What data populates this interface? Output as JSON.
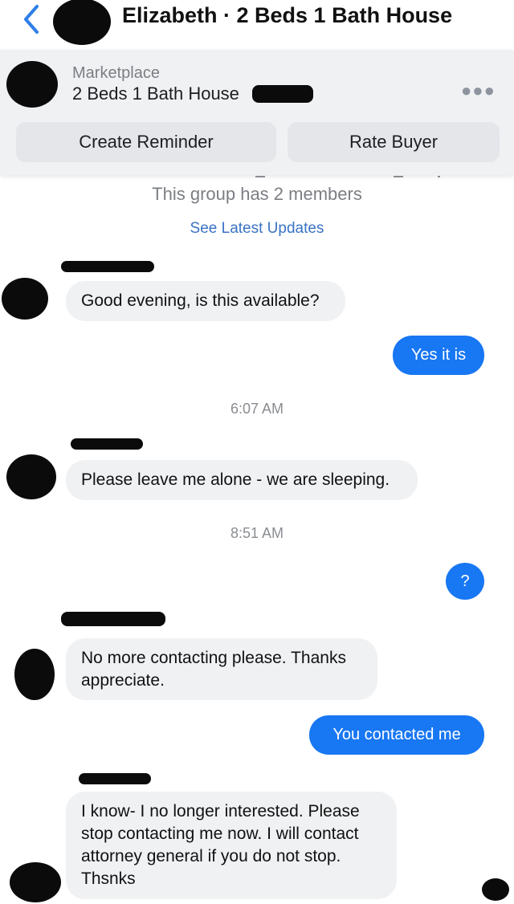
{
  "header": {
    "title": "Elizabeth · 2 Beds 1 Bath House"
  },
  "marketplace": {
    "label": "Marketplace",
    "listing_title": "2 Beds 1 Bath House",
    "create_reminder": "Create Reminder",
    "rate_buyer": "Rate Buyer"
  },
  "group": {
    "members_text": "This group has 2 members",
    "see_updates": "See Latest Updates"
  },
  "messages": [
    {
      "from": "them",
      "text": "Good evening, is this available?"
    },
    {
      "from": "me",
      "text": "Yes it is"
    },
    {
      "type": "time",
      "text": "6:07 AM"
    },
    {
      "from": "them",
      "text": "Please leave me alone - we are sleeping."
    },
    {
      "type": "time",
      "text": "8:51 AM"
    },
    {
      "from": "me",
      "text": "?"
    },
    {
      "from": "them",
      "text": "No more contacting please. Thanks appreciate."
    },
    {
      "from": "me",
      "text": "You contacted me"
    },
    {
      "from": "them",
      "text": "I know- I  no longer interested. Please stop contacting me now. I will contact attorney general if you do not stop. Thsnks"
    }
  ],
  "colors": {
    "accent": "#1877f2",
    "incoming_bubble": "#f0f1f3",
    "link": "#3a73c4"
  }
}
